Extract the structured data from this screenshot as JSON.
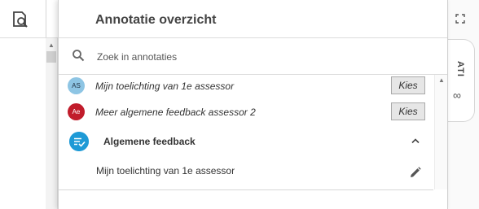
{
  "panel": {
    "title": "Annotatie overzicht",
    "search": {
      "placeholder": "Zoek in annotaties",
      "value": ""
    }
  },
  "annotations": [
    {
      "initials": "AS",
      "text": "Mijn toelichting van 1e assessor",
      "button": "Kies",
      "avatar_color": "#8ec5e4"
    },
    {
      "initials": "Ae",
      "text": "Meer algemene feedback assessor 2",
      "button": "Kies",
      "avatar_color": "#c11c2b"
    }
  ],
  "group": {
    "label": "Algemene feedback",
    "icon": "feedback-check-icon",
    "color": "#1e9ad6",
    "expanded": true,
    "comments": [
      {
        "text": "Mijn toelichting van 1e assessor"
      }
    ]
  },
  "side_tab": {
    "label": "ATI",
    "icon": "infinity-icon"
  },
  "icons": {
    "document_search": "document-search-icon",
    "expand": "expand-icon",
    "search": "search-icon",
    "chevron": "chevron-up-icon",
    "edit": "pencil-icon"
  }
}
